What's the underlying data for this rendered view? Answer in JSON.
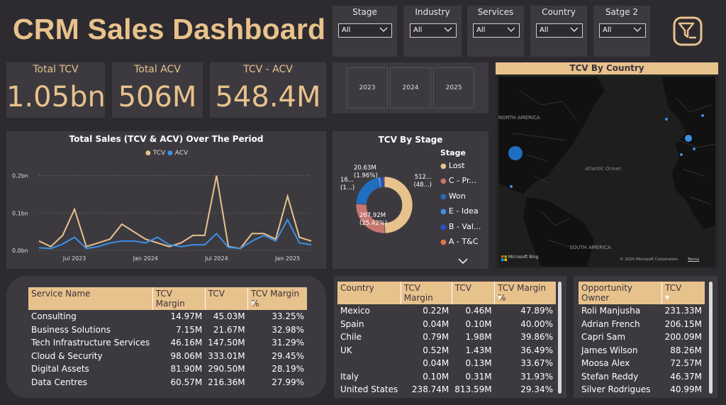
{
  "dashboard_title": "CRM Sales Dashboard",
  "slicers": [
    {
      "label": "Stage",
      "value": "All"
    },
    {
      "label": "Industry",
      "value": "All"
    },
    {
      "label": "Services",
      "value": "All"
    },
    {
      "label": "Country",
      "value": "All"
    },
    {
      "label": "Satge 2",
      "value": "All"
    }
  ],
  "kpis": [
    {
      "label": "Total TCV",
      "value": "1.05bn"
    },
    {
      "label": "Total ACV",
      "value": "506M"
    },
    {
      "label": "TCV - ACV",
      "value": "548.4M"
    }
  ],
  "years": [
    "2023",
    "2024",
    "2025"
  ],
  "map": {
    "title": "TCV By Country",
    "labels": [
      "NORTH AMERICA",
      "Atlantic Ocean",
      "SOUTH AMERICA"
    ],
    "attribution": "Microsoft Bing",
    "copyright": "© 2025 Microsoft Corporation",
    "terms": "Terms"
  },
  "line_chart": {
    "title": "Total Sales (TCV & ACV) Over The Period",
    "legend": [
      {
        "name": "TCV",
        "color": "#e8c28d"
      },
      {
        "name": "ACV",
        "color": "#3b8fe6"
      }
    ],
    "y_ticks": [
      "0.2bn",
      "0.1bn",
      "0.0bn"
    ],
    "x_ticks": [
      "Jul 2023",
      "Jan 2024",
      "Jul 2024",
      "Jan 2025"
    ]
  },
  "chart_data": [
    {
      "type": "line",
      "title": "Total Sales (TCV & ACV) Over The Period",
      "x": [
        "2023-04",
        "2023-05",
        "2023-06",
        "2023-07",
        "2023-08",
        "2023-09",
        "2023-10",
        "2023-11",
        "2023-12",
        "2024-01",
        "2024-02",
        "2024-03",
        "2024-04",
        "2024-05",
        "2024-06",
        "2024-07",
        "2024-08",
        "2024-09",
        "2024-10",
        "2024-11",
        "2024-12",
        "2025-01",
        "2025-02",
        "2025-03"
      ],
      "series": [
        {
          "name": "TCV",
          "values": [
            0.025,
            0.01,
            0.04,
            0.11,
            0.01,
            0.02,
            0.03,
            0.07,
            0.05,
            0.03,
            0.02,
            0.01,
            0.02,
            0.04,
            0.04,
            0.2,
            0.01,
            0.005,
            0.045,
            0.045,
            0.03,
            0.145,
            0.035,
            0.025
          ]
        },
        {
          "name": "ACV",
          "values": [
            0.007,
            0.005,
            0.017,
            0.035,
            0.005,
            0.01,
            0.02,
            0.025,
            0.025,
            0.02,
            0.035,
            0.015,
            0.01,
            0.015,
            0.015,
            0.045,
            0.008,
            0.005,
            0.025,
            0.04,
            0.025,
            0.082,
            0.02,
            0.015
          ]
        }
      ],
      "ylim": [
        0,
        0.22
      ],
      "ylabel": "",
      "xlabel": ""
    },
    {
      "type": "pie",
      "title": "TCV By Stage",
      "legend_title": "Stage",
      "categories": [
        "Lost",
        "C - Pr...",
        "Won",
        "E - Idea",
        "B - Val...",
        "A - T&C"
      ],
      "values": [
        512,
        267.92,
        210,
        20.63,
        16,
        5
      ],
      "colors": [
        "#e8c28d",
        "#c4766f",
        "#1f6ec2",
        "#3b8fe6",
        "#2b4fcf",
        "#e0734a"
      ],
      "data_labels": [
        {
          "value": "512...",
          "pct": "(48...)"
        },
        {
          "value": "267.92M",
          "pct": "(25.42%)"
        },
        {
          "value": "20.63M",
          "pct": "(1.96%)"
        },
        {
          "value": "16...",
          "pct": "(1...)"
        }
      ]
    }
  ],
  "service_table": {
    "headers": [
      "Service Name",
      "TCV Margin",
      "TCV",
      "TCV Margin %"
    ],
    "rows": [
      [
        "Consulting",
        "14.97M",
        "45.03M",
        "33.25%"
      ],
      [
        "Business Solutions",
        "7.15M",
        "21.67M",
        "32.98%"
      ],
      [
        "Tech Infrastructure Services",
        "46.16M",
        "147.50M",
        "31.29%"
      ],
      [
        "Cloud & Security",
        "98.06M",
        "333.01M",
        "29.45%"
      ],
      [
        "Digital Assets",
        "81.90M",
        "290.50M",
        "28.19%"
      ],
      [
        "Data Centres",
        "60.57M",
        "216.36M",
        "27.99%"
      ]
    ]
  },
  "country_table": {
    "headers": [
      "Country",
      "TCV Margin",
      "TCV",
      "TCV Margin %"
    ],
    "rows": [
      [
        "Mexico",
        "0.22M",
        "0.46M",
        "47.89%"
      ],
      [
        "Spain",
        "0.04M",
        "0.10M",
        "40.00%"
      ],
      [
        "Chile",
        "0.79M",
        "1.98M",
        "39.86%"
      ],
      [
        "UK",
        "0.52M",
        "1.43M",
        "36.49%"
      ],
      [
        "",
        "0.04M",
        "0.13M",
        "33.67%"
      ],
      [
        "Italy",
        "0.10M",
        "0.31M",
        "31.93%"
      ],
      [
        "United States",
        "238.74M",
        "813.59M",
        "29.34%"
      ]
    ]
  },
  "owner_table": {
    "headers": [
      "Opportunity Owner",
      "TCV"
    ],
    "rows": [
      [
        "Roli Manjusha",
        "231.33M"
      ],
      [
        "Adrian French",
        "206.15M"
      ],
      [
        "Capri Sam",
        "200.09M"
      ],
      [
        "James Wilson",
        "88.26M"
      ],
      [
        "Moosa Alex",
        "72.57M"
      ],
      [
        "Stefan Reddy",
        "46.37M"
      ],
      [
        "Silver Rodrigues",
        "40.99M"
      ]
    ]
  }
}
